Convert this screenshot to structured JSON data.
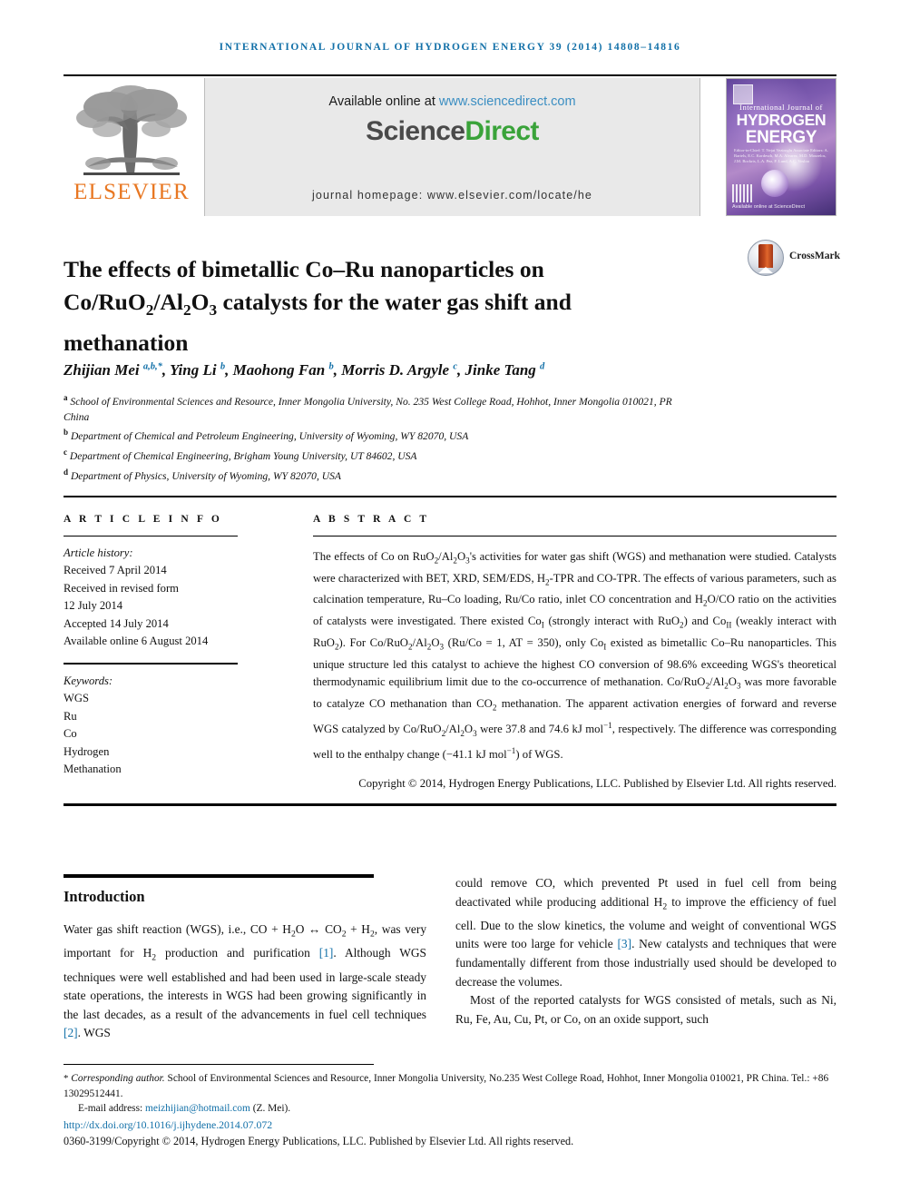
{
  "running_head": "INTERNATIONAL JOURNAL OF HYDROGEN ENERGY 39 (2014) 14808–14816",
  "masthead": {
    "publisher_name": "ELSEVIER",
    "available_prefix": "Available online at ",
    "available_url": "www.sciencedirect.com",
    "brand_first": "Science",
    "brand_second": "Direct",
    "homepage": "journal homepage: www.elsevier.com/locate/he",
    "cover": {
      "line_small": "International Journal of",
      "line_big_1": "HYDROGEN",
      "line_big_2": "ENERGY",
      "editors": "Editor-in-Chief: T. Nejat Veziroglu   Associate Editors: A. Bartels, E.C. Kordesch, M.A. Alvarez, M.D. Mourelos, J.M. Bockris, L.A. Pez, F. Lund, A.C. Vosloo",
      "footer_mark": "Available online at ScienceDirect"
    }
  },
  "article": {
    "title_lines": [
      "The effects of bimetallic Co–Ru nanoparticles on",
      "Co/RuO2/Al2O3 catalysts for the water gas shift and",
      "methanation"
    ],
    "crossmark_label": "CrossMark",
    "authors_plain": "Zhijian Mei a,b,*, Ying Li b, Maohong Fan b, Morris D. Argyle c, Jinke Tang d",
    "affiliations": [
      {
        "marker": "a",
        "text": "School of Environmental Sciences and Resource, Inner Mongolia University, No. 235 West College Road, Hohhot, Inner Mongolia 010021, PR China"
      },
      {
        "marker": "b",
        "text": "Department of Chemical and Petroleum Engineering, University of Wyoming, WY 82070, USA"
      },
      {
        "marker": "c",
        "text": "Department of Chemical Engineering, Brigham Young University, UT 84602, USA"
      },
      {
        "marker": "d",
        "text": "Department of Physics, University of Wyoming, WY 82070, USA"
      }
    ]
  },
  "article_info": {
    "heading": "A R T I C L E   I N F O",
    "history_label": "Article history:",
    "history": [
      "Received 7 April 2014",
      "Received in revised form",
      "12 July 2014",
      "Accepted 14 July 2014",
      "Available online 6 August 2014"
    ],
    "keywords_label": "Keywords:",
    "keywords": [
      "WGS",
      "Ru",
      "Co",
      "Hydrogen",
      "Methanation"
    ]
  },
  "abstract": {
    "heading": "A B S T R A C T",
    "copyright": "Copyright © 2014, Hydrogen Energy Publications, LLC. Published by Elsevier Ltd. All rights reserved."
  },
  "body": {
    "intro_heading": "Introduction",
    "right_paragraph_2_prefix": "Most of the reported catalysts for WGS consisted of metals, such as Ni, Ru, Fe, Au, Cu, Pt, or Co, on an oxide support, such"
  },
  "footer": {
    "corresponding_label": "Corresponding author.",
    "corresponding_text": " School of Environmental Sciences and Resource, Inner Mongolia University, No.235 West College Road, Hohhot, Inner Mongolia 010021, PR China. Tel.: +86 13029512441.",
    "email_label": "E-mail address: ",
    "email": "meizhijian@hotmail.com",
    "email_suffix": " (Z. Mei).",
    "doi": "http://dx.doi.org/10.1016/j.ijhydene.2014.07.072",
    "issn": "0360-3199/Copyright © 2014, Hydrogen Energy Publications, LLC. Published by Elsevier Ltd. All rights reserved."
  },
  "colors": {
    "journal_blue": "#1270a8",
    "elsevier_orange": "#e87722",
    "sciencedirect_green": "#3aa33a",
    "band_gray": "#e9e9e9"
  }
}
